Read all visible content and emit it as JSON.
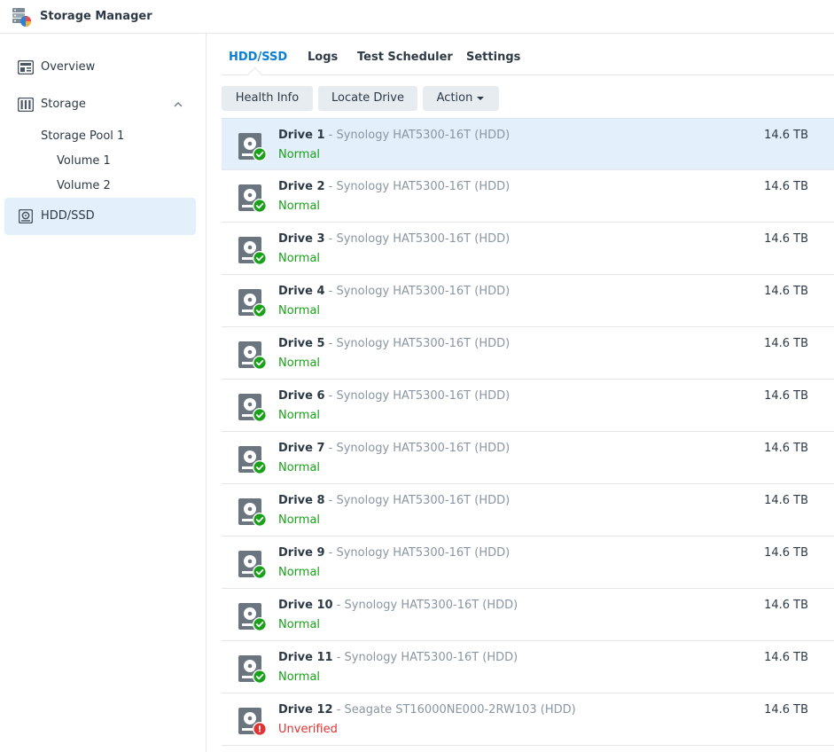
{
  "app": {
    "title": "Storage Manager"
  },
  "sidebar": {
    "items": [
      {
        "label": "Overview"
      },
      {
        "label": "Storage"
      },
      {
        "label": "HDD/SSD"
      }
    ],
    "storage_children": [
      {
        "label": "Storage Pool 1"
      },
      {
        "label": "Volume 1"
      },
      {
        "label": "Volume 2"
      }
    ]
  },
  "tabs": [
    {
      "label": "HDD/SSD",
      "active": true
    },
    {
      "label": "Logs"
    },
    {
      "label": "Test Scheduler"
    },
    {
      "label": "Settings"
    }
  ],
  "toolbar": {
    "health_info": "Health Info",
    "locate_drive": "Locate Drive",
    "action": "Action"
  },
  "colors": {
    "accent": "#0a7fd5",
    "selected_row": "#e3effb",
    "status_ok": "#1aa11a",
    "status_bad": "#e03333"
  },
  "drives": [
    {
      "name": "Drive 1",
      "model": " - Synology HAT5300-16T (HDD)",
      "status": "Normal",
      "size": "14.6 TB",
      "state": "ok"
    },
    {
      "name": "Drive 2",
      "model": " - Synology HAT5300-16T (HDD)",
      "status": "Normal",
      "size": "14.6 TB",
      "state": "ok"
    },
    {
      "name": "Drive 3",
      "model": " - Synology HAT5300-16T (HDD)",
      "status": "Normal",
      "size": "14.6 TB",
      "state": "ok"
    },
    {
      "name": "Drive 4",
      "model": " - Synology HAT5300-16T (HDD)",
      "status": "Normal",
      "size": "14.6 TB",
      "state": "ok"
    },
    {
      "name": "Drive 5",
      "model": " - Synology HAT5300-16T (HDD)",
      "status": "Normal",
      "size": "14.6 TB",
      "state": "ok"
    },
    {
      "name": "Drive 6",
      "model": " - Synology HAT5300-16T (HDD)",
      "status": "Normal",
      "size": "14.6 TB",
      "state": "ok"
    },
    {
      "name": "Drive 7",
      "model": " - Synology HAT5300-16T (HDD)",
      "status": "Normal",
      "size": "14.6 TB",
      "state": "ok"
    },
    {
      "name": "Drive 8",
      "model": " - Synology HAT5300-16T (HDD)",
      "status": "Normal",
      "size": "14.6 TB",
      "state": "ok"
    },
    {
      "name": "Drive 9",
      "model": " - Synology HAT5300-16T (HDD)",
      "status": "Normal",
      "size": "14.6 TB",
      "state": "ok"
    },
    {
      "name": "Drive 10",
      "model": " - Synology HAT5300-16T (HDD)",
      "status": "Normal",
      "size": "14.6 TB",
      "state": "ok"
    },
    {
      "name": "Drive 11",
      "model": " - Synology HAT5300-16T (HDD)",
      "status": "Normal",
      "size": "14.6 TB",
      "state": "ok"
    },
    {
      "name": "Drive 12",
      "model": " - Seagate ST16000NE000-2RW103 (HDD)",
      "status": "Unverified",
      "size": "14.6 TB",
      "state": "bad"
    }
  ]
}
